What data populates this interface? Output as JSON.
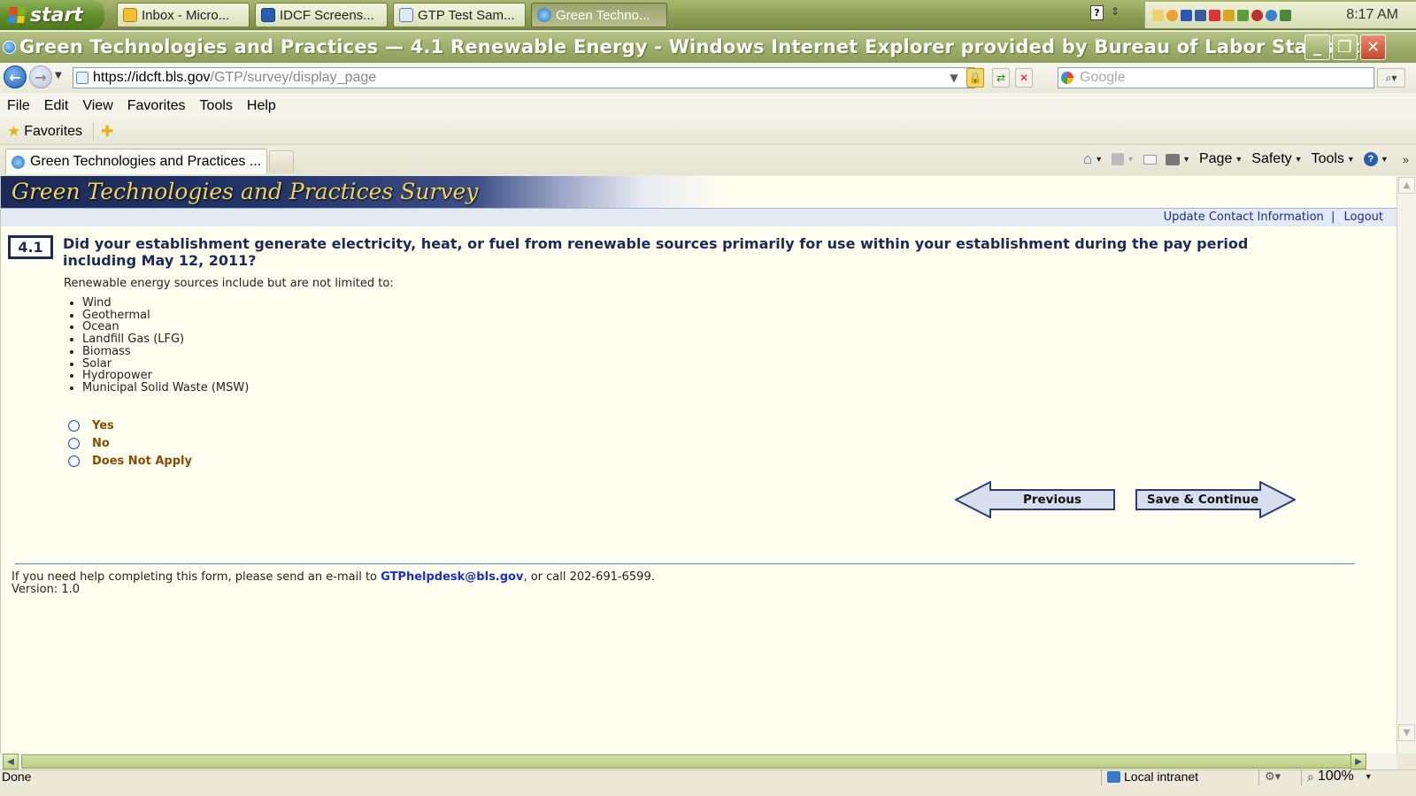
{
  "taskbar": {
    "start_label": "start",
    "buttons": [
      {
        "label": "Inbox - Micro...",
        "icon": "outlook-icon"
      },
      {
        "label": "IDCF Screens...",
        "icon": "word-icon"
      },
      {
        "label": "GTP Test Sam...",
        "icon": "document-icon"
      },
      {
        "label": "Green Techno...",
        "icon": "ie-icon"
      }
    ],
    "clock": "8:17 AM"
  },
  "window": {
    "title": "Green Technologies and Practices — 4.1 Renewable Energy - Windows Internet Explorer provided by Bureau of Labor Statistics"
  },
  "address": {
    "host": "https://idcft.bls.gov",
    "path": "/GTP/survey/display_page",
    "search_placeholder": "Google"
  },
  "menu": [
    "File",
    "Edit",
    "View",
    "Favorites",
    "Tools",
    "Help"
  ],
  "favorites": {
    "label": "Favorites"
  },
  "tab": {
    "label": "Green Technologies and Practices ..."
  },
  "command_bar": {
    "page": "Page",
    "safety": "Safety",
    "tools": "Tools"
  },
  "page": {
    "banner_title": "Green Technologies and Practices Survey",
    "links": {
      "update_contact": "Update Contact Information",
      "separator": "|",
      "logout": "Logout"
    },
    "question": {
      "number": "4.1",
      "text": "Did your establishment generate electricity, heat, or fuel from renewable sources primarily for use within your establishment during the pay period including May 12, 2011?",
      "intro": "Renewable energy sources include but are not limited to:",
      "sources": [
        "Wind",
        "Geothermal",
        "Ocean",
        "Landfill Gas (LFG)",
        "Biomass",
        "Solar",
        "Hydropower",
        "Municipal Solid Waste (MSW)"
      ],
      "options": [
        "Yes",
        "No",
        "Does Not Apply"
      ]
    },
    "buttons": {
      "previous": "Previous",
      "save_continue": "Save & Continue"
    },
    "footer": {
      "help_prefix": "If you need help completing this form, please send an e-mail to ",
      "help_email": "GTPhelpdesk@bls.gov",
      "help_suffix": ", or call 202-691-6599.",
      "version": "Version: 1.0"
    }
  },
  "status": {
    "text": "Done",
    "zone": "Local intranet",
    "zoom": "100%"
  },
  "colors": {
    "question_blue": "#1b2a57",
    "option_brown": "#8b4a07",
    "content_bg": "#fffff0",
    "link_blue": "#1a2ed8"
  }
}
